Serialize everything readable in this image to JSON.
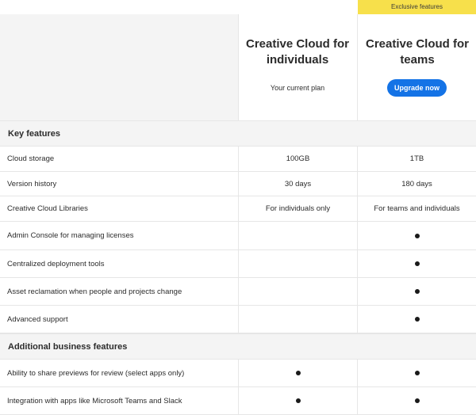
{
  "header": {
    "exclusive_badge": "Exclusive features",
    "individuals": {
      "title": "Creative Cloud for individuals",
      "subtitle": "Your current plan"
    },
    "teams": {
      "title": "Creative Cloud for teams",
      "button": "Upgrade now"
    }
  },
  "sections": {
    "key": {
      "label": "Key features"
    },
    "additional": {
      "label": "Additional business features"
    }
  },
  "rows": [
    {
      "feature": "Cloud storage",
      "individuals": "100GB",
      "teams": "1TB"
    },
    {
      "feature": "Version history",
      "individuals": "30 days",
      "teams": "180 days"
    },
    {
      "feature": "Creative Cloud Libraries",
      "individuals": "For individuals only",
      "teams": "For teams and individuals"
    },
    {
      "feature": "Admin Console for managing licenses",
      "individuals_check": false,
      "teams_check": true
    },
    {
      "feature": "Centralized deployment tools",
      "individuals_check": false,
      "teams_check": true
    },
    {
      "feature": "Asset reclamation when people and projects change",
      "individuals_check": false,
      "teams_check": true
    },
    {
      "feature": "Advanced support",
      "individuals_check": false,
      "teams_check": true
    },
    {
      "feature": "Ability to share previews for review (select apps only)",
      "individuals_check": true,
      "teams_check": true
    },
    {
      "feature": "Integration with apps like Microsoft Teams and Slack",
      "individuals_check": true,
      "teams_check": true
    }
  ],
  "colors": {
    "accent": "#1473e6",
    "badge": "#f7e04b",
    "section_bg": "#f4f4f4"
  },
  "icons": {
    "included": "bullet-dot-icon"
  }
}
